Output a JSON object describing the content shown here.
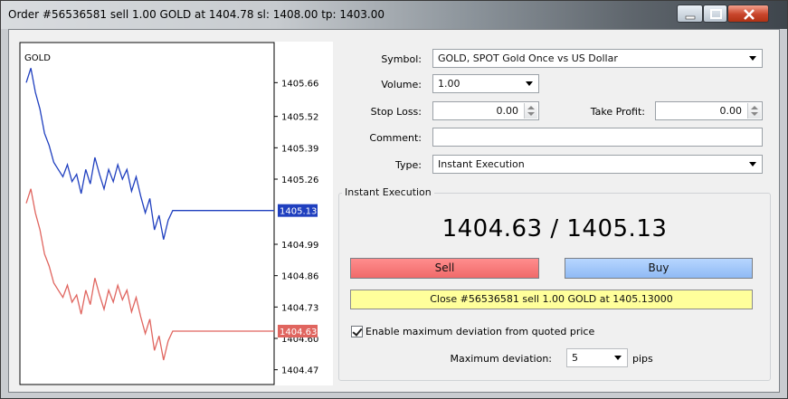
{
  "window": {
    "title": "Order #56536581 sell 1.00 GOLD at 1404.78 sl: 1408.00 tp: 1403.00"
  },
  "chart": {
    "symbol": "GOLD",
    "y_ticks": [
      "1405.66",
      "1405.52",
      "1405.39",
      "1405.26",
      "1404.99",
      "1404.86",
      "1404.73",
      "1404.60",
      "1404.47"
    ],
    "ask_badge": "1405.13",
    "bid_badge": "1404.63",
    "ask_color": "#1f3fbf",
    "bid_color": "#e0655f"
  },
  "chart_data": {
    "type": "line",
    "title": "GOLD",
    "xlabel": "",
    "ylabel": "",
    "ylim": [
      1404.42,
      1405.8
    ],
    "y_ticks": [
      1405.66,
      1405.52,
      1405.39,
      1405.26,
      1405.13,
      1404.99,
      1404.86,
      1404.73,
      1404.6,
      1404.47
    ],
    "series": [
      {
        "values": [
          1405.66,
          1405.72,
          1405.62,
          1405.55,
          1405.45,
          1405.4,
          1405.33,
          1405.3,
          1405.27,
          1405.32,
          1405.25,
          1405.28,
          1405.2,
          1405.3,
          1405.24,
          1405.35,
          1405.28,
          1405.22,
          1405.3,
          1405.25,
          1405.32,
          1405.26,
          1405.3,
          1405.21,
          1405.27,
          1405.19,
          1405.12,
          1405.18,
          1405.05,
          1405.11,
          1405.01,
          1405.09,
          1405.13,
          1405.13
        ]
      },
      {
        "values": [
          1405.16,
          1405.22,
          1405.12,
          1405.05,
          1404.95,
          1404.9,
          1404.83,
          1404.8,
          1404.77,
          1404.82,
          1404.75,
          1404.78,
          1404.7,
          1404.8,
          1404.74,
          1404.85,
          1404.78,
          1404.72,
          1404.8,
          1404.75,
          1404.82,
          1404.76,
          1404.8,
          1404.71,
          1404.77,
          1404.69,
          1404.62,
          1404.68,
          1404.55,
          1404.61,
          1404.51,
          1404.59,
          1404.63,
          1404.63
        ]
      }
    ]
  },
  "form": {
    "symbol_label": "Symbol:",
    "symbol_value": "GOLD, SPOT Gold Once vs US Dollar",
    "volume_label": "Volume:",
    "volume_value": "1.00",
    "stoploss_label": "Stop Loss:",
    "stoploss_value": "0.00",
    "takeprofit_label": "Take Profit:",
    "takeprofit_value": "0.00",
    "comment_label": "Comment:",
    "comment_value": "",
    "type_label": "Type:",
    "type_value": "Instant Execution"
  },
  "execution": {
    "group_title": "Instant Execution",
    "bid": "1404.63",
    "separator": "/",
    "ask": "1405.13",
    "sell_label": "Sell",
    "buy_label": "Buy",
    "close_label": "Close #56536581 sell 1.00 GOLD at 1405.13000",
    "sell_color": "#f47a7a",
    "buy_color": "#a3c7f8",
    "close_color": "#ffff9b",
    "deviation_checkbox_label": "Enable maximum deviation from quoted price",
    "deviation_checked": true,
    "max_deviation_label": "Maximum deviation:",
    "max_deviation_value": "5",
    "pips_label": "pips"
  }
}
